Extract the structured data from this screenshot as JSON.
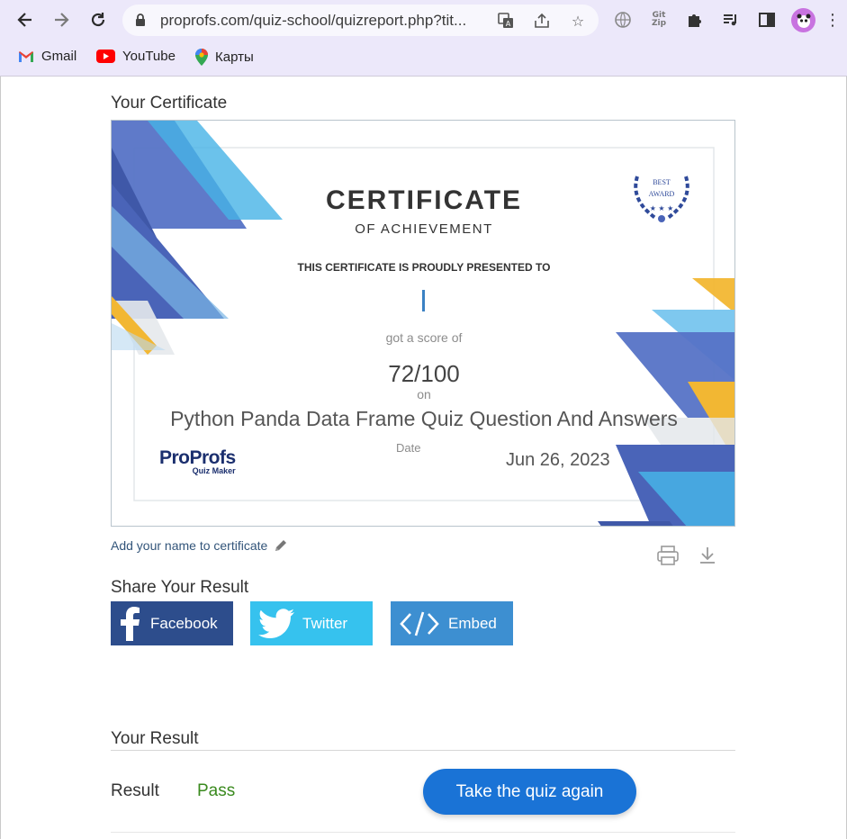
{
  "browser": {
    "url": "proprofs.com/quiz-school/quizreport.php?tit...",
    "bookmarks": [
      {
        "label": "Gmail",
        "icon": "gmail-icon"
      },
      {
        "label": "YouTube",
        "icon": "youtube-icon"
      },
      {
        "label": "Карты",
        "icon": "maps-icon"
      }
    ],
    "extension_gitzip_label": "Git Zip"
  },
  "page": {
    "certificate_heading": "Your Certificate",
    "certificate": {
      "title": "CERTIFICATE",
      "subtitle": "OF ACHIEVEMENT",
      "presented": "THIS CERTIFICATE IS PROUDLY PRESENTED TO",
      "name": "",
      "score_label": "got a score of",
      "score": "72/100",
      "on_label": "on",
      "quiz_title": "Python Panda Data Frame Quiz Question And Answers",
      "date_label": "Date",
      "date": "Jun 26, 2023",
      "badge_top": "BEST",
      "badge_bottom": "AWARD",
      "logo_main": "ProProfs",
      "logo_sub": "Quiz Maker"
    },
    "add_name_link": "Add your name to certificate",
    "share_heading": "Share Your Result",
    "share_buttons": [
      {
        "label": "Facebook",
        "color": "#2d4d8c"
      },
      {
        "label": "Twitter",
        "color": "#36c2ee"
      },
      {
        "label": "Embed",
        "color": "#3d8fd1"
      }
    ],
    "result_heading": "Your Result",
    "result_label": "Result",
    "result_value": "Pass",
    "retake_label": "Take the quiz again"
  },
  "colors": {
    "accent": "#1a73d6",
    "pass": "#3a8a1e",
    "toolbar": "#ece8fa"
  }
}
